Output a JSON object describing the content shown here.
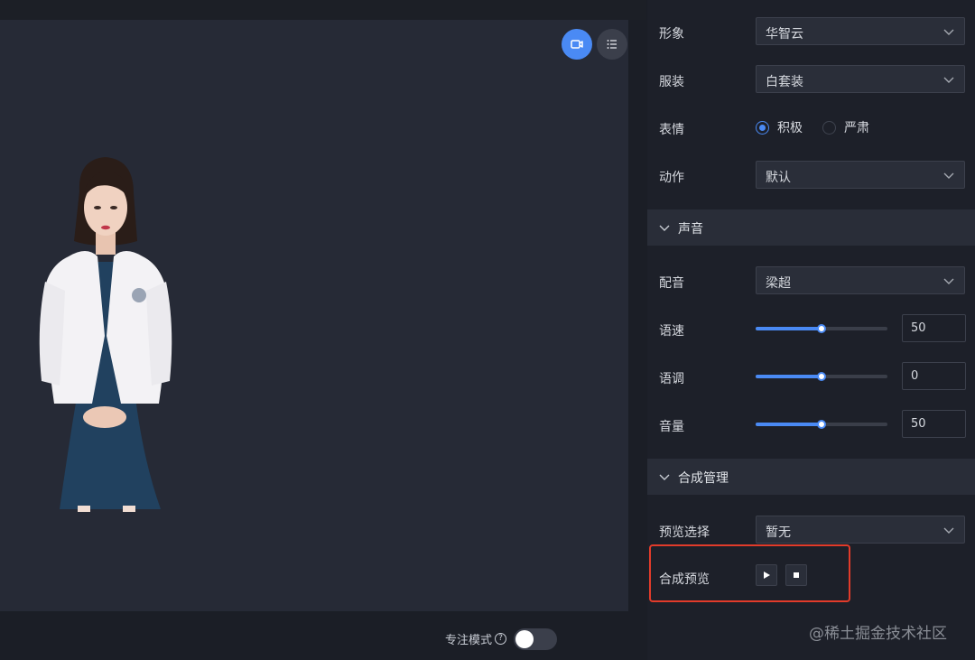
{
  "stage": {
    "camera_button": "video-camera-icon",
    "list_button": "list-icon",
    "focus_mode_label": "专注模式",
    "focus_mode_on": false
  },
  "panel": {
    "appearance": {
      "label": "形象",
      "value": "华智云"
    },
    "costume": {
      "label": "服装",
      "value": "白套装"
    },
    "expression": {
      "label": "表情",
      "options": [
        "积极",
        "严肃"
      ],
      "selected": "积极"
    },
    "action": {
      "label": "动作",
      "value": "默认"
    },
    "sound_section": {
      "title": "声音"
    },
    "voice": {
      "label": "配音",
      "value": "梁超"
    },
    "speed": {
      "label": "语速",
      "value": "50",
      "fraction": 0.5
    },
    "pitch": {
      "label": "语调",
      "value": "0",
      "fraction": 0.5
    },
    "volume": {
      "label": "音量",
      "value": "50",
      "fraction": 0.5
    },
    "synthesis_section": {
      "title": "合成管理"
    },
    "preview_select": {
      "label": "预览选择",
      "value": "暂无"
    },
    "synthesis_preview": {
      "label": "合成预览"
    }
  },
  "watermark": "@稀土掘金技术社区",
  "colors": {
    "accent": "#4a8af4",
    "highlight": "#e23b2a"
  }
}
